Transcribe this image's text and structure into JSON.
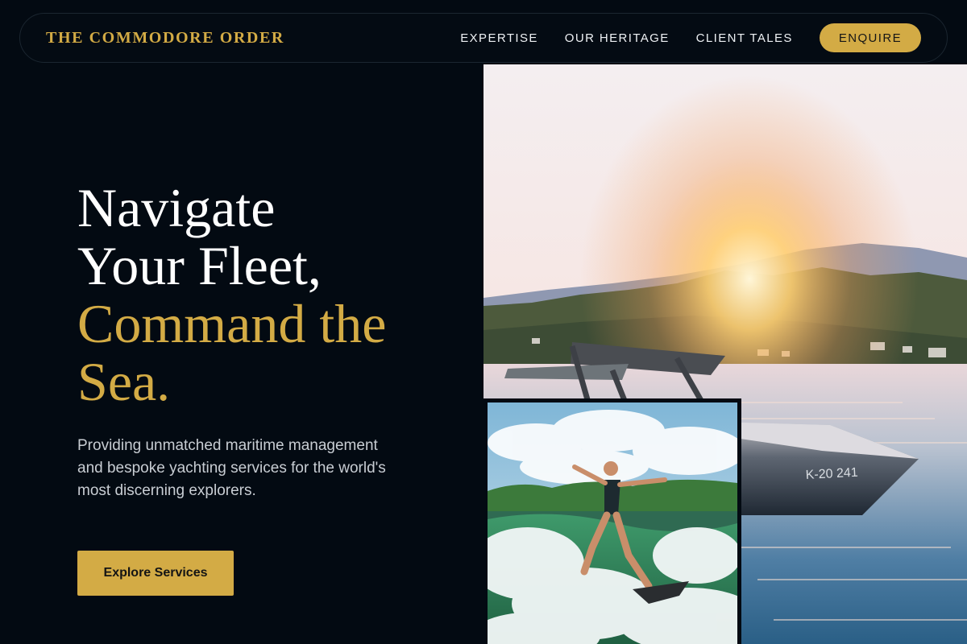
{
  "nav": {
    "brand": "THE COMMODORE ORDER",
    "links": [
      {
        "label": "EXPERTISE"
      },
      {
        "label": "OUR HERITAGE"
      },
      {
        "label": "CLIENT TALES"
      }
    ],
    "enquire_label": "ENQUIRE"
  },
  "hero": {
    "headline_white_line1": "Navigate",
    "headline_white_line2": "Your Fleet,",
    "headline_gold_line1": "Command the",
    "headline_gold_line2": "Sea.",
    "lede": "Providing unmatched maritime management and bespoke yachting services for the world's most discerning explorers.",
    "cta_label": "Explore Services"
  },
  "images": {
    "boat_registration": "K-20 241"
  },
  "colors": {
    "background": "#030a12",
    "accent_gold": "#d3ab45",
    "text_white": "#ffffff",
    "text_muted": "#c8cdd3"
  }
}
